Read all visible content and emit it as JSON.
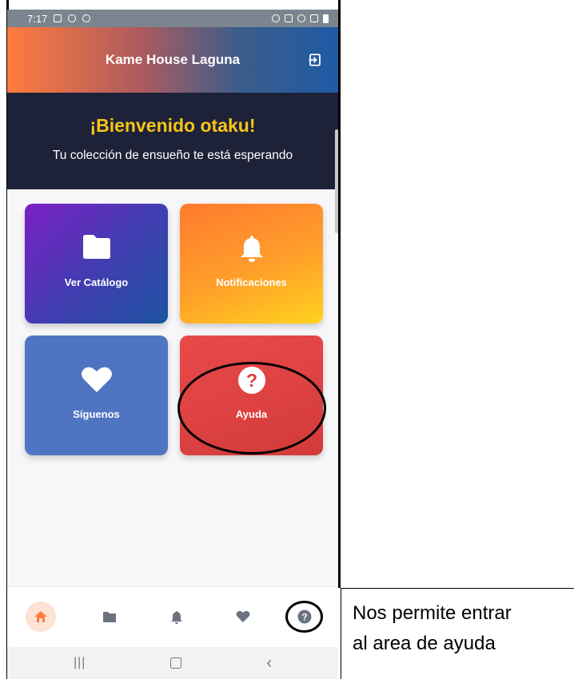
{
  "status_bar": {
    "time": "7:17"
  },
  "app_bar": {
    "title": "Kame House Laguna"
  },
  "banner": {
    "title": "¡Bienvenido otaku!",
    "subtitle": "Tu colección de ensueño te está esperando"
  },
  "cards": {
    "catalog": {
      "label": "Ver Catálogo",
      "icon": "folder-icon"
    },
    "notifications": {
      "label": "Notificaciones",
      "icon": "bell-icon"
    },
    "follow": {
      "label": "Síguenos",
      "icon": "heart-icon"
    },
    "help": {
      "label": "Ayuda",
      "icon": "question-icon"
    }
  },
  "bottom_nav": {
    "items": [
      {
        "icon": "home-icon",
        "active": true
      },
      {
        "icon": "folder-icon",
        "active": false
      },
      {
        "icon": "bell-icon",
        "active": false
      },
      {
        "icon": "heart-icon",
        "active": false
      },
      {
        "icon": "help-icon",
        "active": false
      }
    ]
  },
  "annotation": {
    "line1": "Nos permite entrar",
    "line2": "al area de ayuda"
  },
  "colors": {
    "accent": "#ff7b3e",
    "banner_title": "#f5c518",
    "banner_bg": "#1e2238",
    "help_card": "#e04444",
    "follow_card": "#4f75c2"
  }
}
